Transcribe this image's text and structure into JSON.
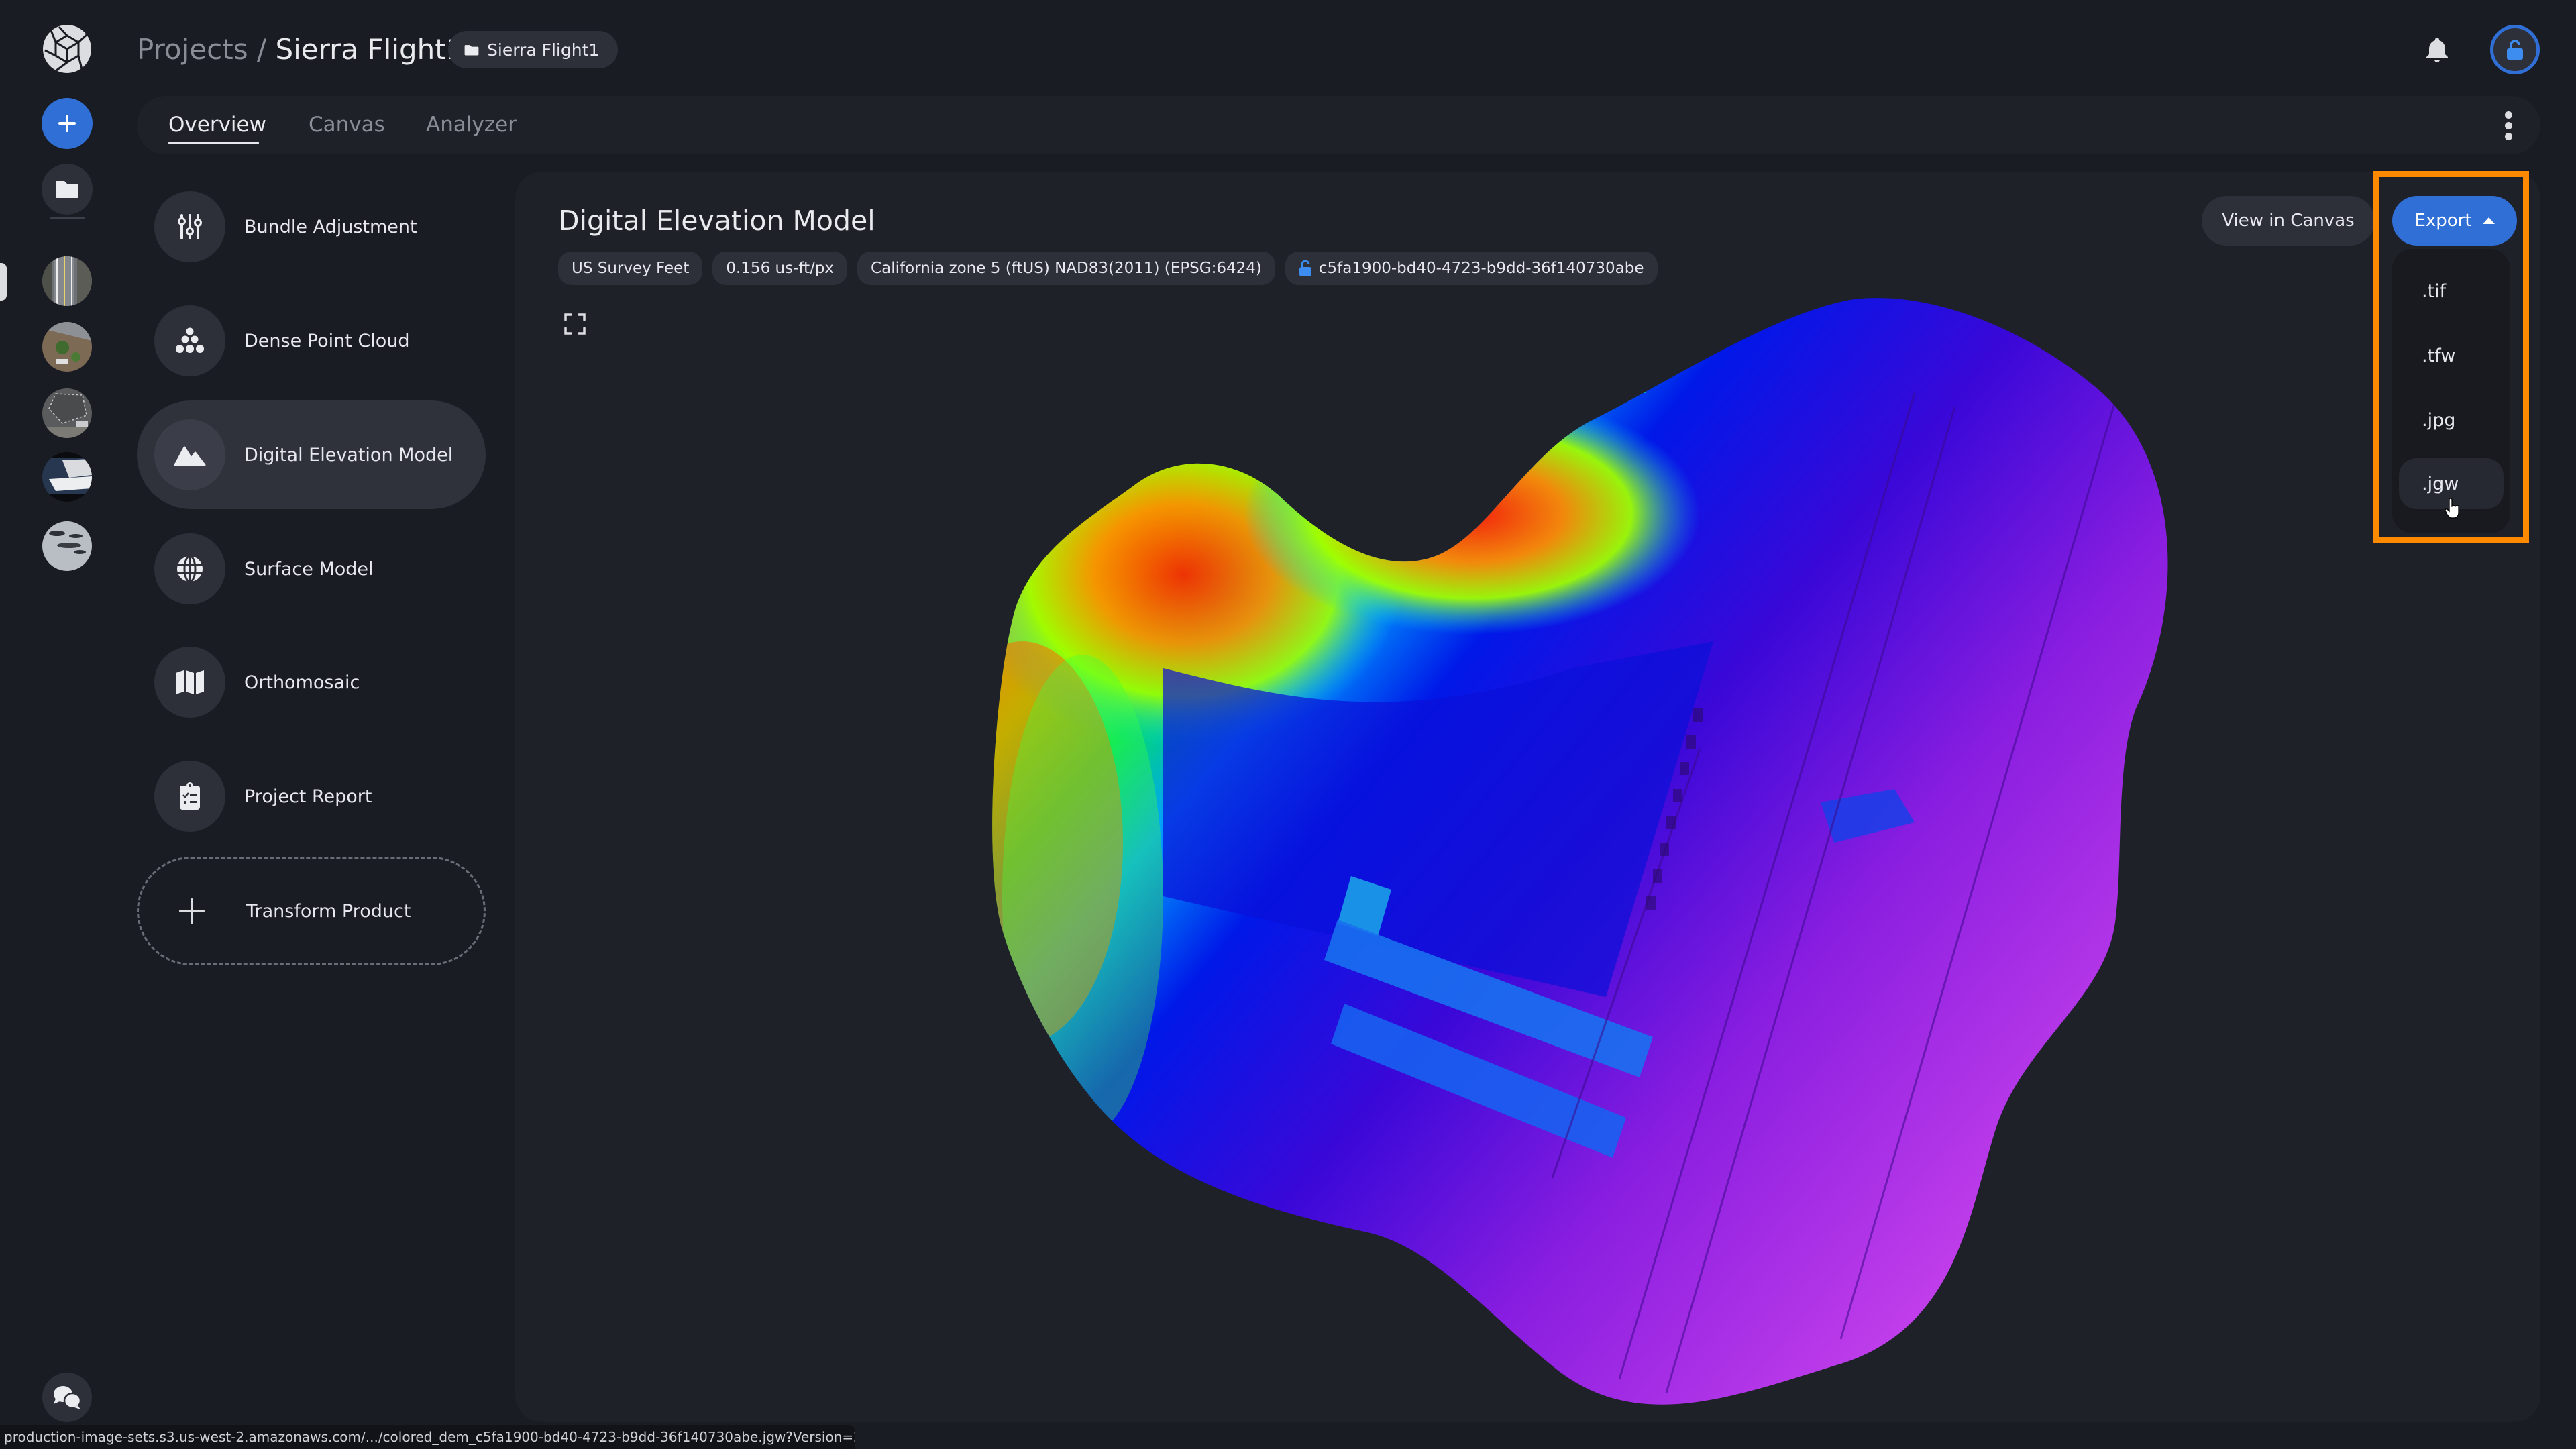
{
  "app": {
    "logo_icon": "aperture-logo-icon"
  },
  "rail": {
    "new_button_icon": "plus-icon",
    "projects_button_icon": "folder-icon",
    "recent_projects": [
      {
        "name": "project-thumbnail-road",
        "active": true
      },
      {
        "name": "project-thumbnail-lot",
        "active": false
      },
      {
        "name": "project-thumbnail-field",
        "active": false
      },
      {
        "name": "project-thumbnail-snow",
        "active": false
      },
      {
        "name": "project-thumbnail-ice",
        "active": false
      }
    ],
    "chat_icon": "chat-bubbles-icon"
  },
  "header": {
    "breadcrumb_root": "Projects",
    "breadcrumb_separator": "/",
    "breadcrumb_current": "Sierra Flight1",
    "project_chip": "Sierra Flight1",
    "notifications_icon": "bell-icon",
    "avatar_icon": "unlock-icon"
  },
  "tabs": [
    {
      "label": "Overview",
      "active": true
    },
    {
      "label": "Canvas",
      "active": false
    },
    {
      "label": "Analyzer",
      "active": false
    }
  ],
  "products": [
    {
      "label": "Bundle Adjustment",
      "icon": "sliders-icon",
      "active": false
    },
    {
      "label": "Dense Point Cloud",
      "icon": "point-cloud-icon",
      "active": false
    },
    {
      "label": "Digital Elevation Model",
      "icon": "mountain-icon",
      "active": true
    },
    {
      "label": "Surface Model",
      "icon": "globe-icon",
      "active": false
    },
    {
      "label": "Orthomosaic",
      "icon": "map-icon",
      "active": false
    },
    {
      "label": "Project Report",
      "icon": "clipboard-list-icon",
      "active": false
    }
  ],
  "transform_product": {
    "label": "Transform Product",
    "icon": "plus-icon"
  },
  "main": {
    "title": "Digital Elevation Model",
    "chips": {
      "units": "US Survey Feet",
      "resolution": "0.156 us-ft/px",
      "crs": "California zone 5 (ftUS) NAD83(2011) (EPSG:6424)",
      "id": "c5fa1900-bd40-4723-b9dd-36f140730abe"
    },
    "view_button": "View in Canvas",
    "export_button": "Export",
    "export_open": true,
    "export_options": [
      ".tif",
      ".tfw",
      ".jpg",
      ".jgw"
    ],
    "hovered_option": ".jgw",
    "preview_alt": "Colored digital elevation model preview"
  },
  "colors": {
    "accent": "#2f6fd6",
    "highlight": "#ff8a00",
    "background": "#1a1c23",
    "panel": "#1f2129"
  },
  "status_url": "production-image-sets.s3.us-west-2.amazonaws.com/.../colored_dem_c5fa1900-bd40-4723-b9dd-36f140730abe.jgw?Version=2006-03-01..."
}
